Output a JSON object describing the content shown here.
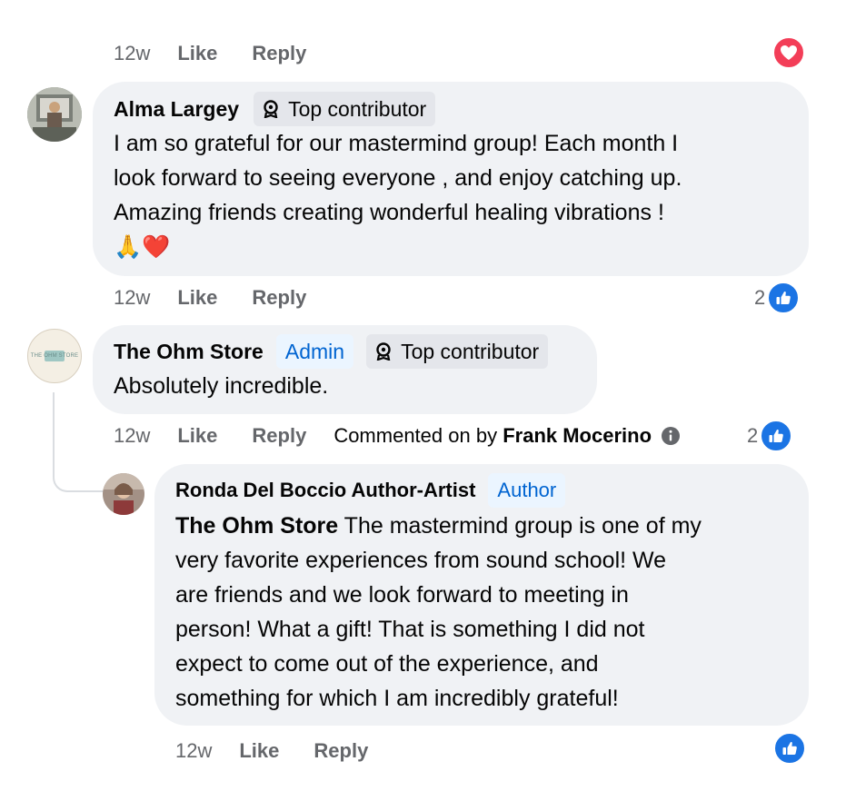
{
  "top_actions": {
    "time": "12w",
    "like": "Like",
    "reply": "Reply"
  },
  "comments": [
    {
      "author": "Alma Largey",
      "badge": "Top contributor",
      "text_lines": [
        "I am so grateful for our mastermind group! Each month I",
        "look forward to seeing everyone , and enjoy catching up.",
        "Amazing friends creating wonderful healing vibrations !",
        "🙏❤️"
      ],
      "time": "12w",
      "like": "Like",
      "reply": "Reply",
      "reaction_count": "2"
    },
    {
      "author": "The Ohm Store",
      "avatar_text": "THE OHM STORE",
      "role": "Admin",
      "badge": "Top contributor",
      "text_lines": [
        "Absolutely incredible."
      ],
      "time": "12w",
      "like": "Like",
      "reply": "Reply",
      "commented_on": "Commented on by",
      "commented_by": "Frank Mocerino",
      "reaction_count": "2"
    },
    {
      "author": "Ronda Del Boccio Author-Artist",
      "role": "Author",
      "mention": "The Ohm Store",
      "text_lines": [
        " The mastermind group is one of my",
        "very favorite experiences from sound school! We",
        "are friends and we look forward to meeting in",
        "person! What a gift! That is something I did not",
        "expect to come out of the experience, and",
        "something for which I am incredibly grateful!"
      ],
      "time": "12w",
      "like": "Like",
      "reply": "Reply"
    }
  ],
  "colors": {
    "bubble": "#f0f2f5",
    "meta": "#65676b",
    "like_blue": "#1b74e4",
    "heart_red": "#f33e58",
    "role_blue": "#0064d1"
  },
  "icons": [
    "heart-icon",
    "like-icon",
    "badge-icon",
    "info-icon"
  ]
}
